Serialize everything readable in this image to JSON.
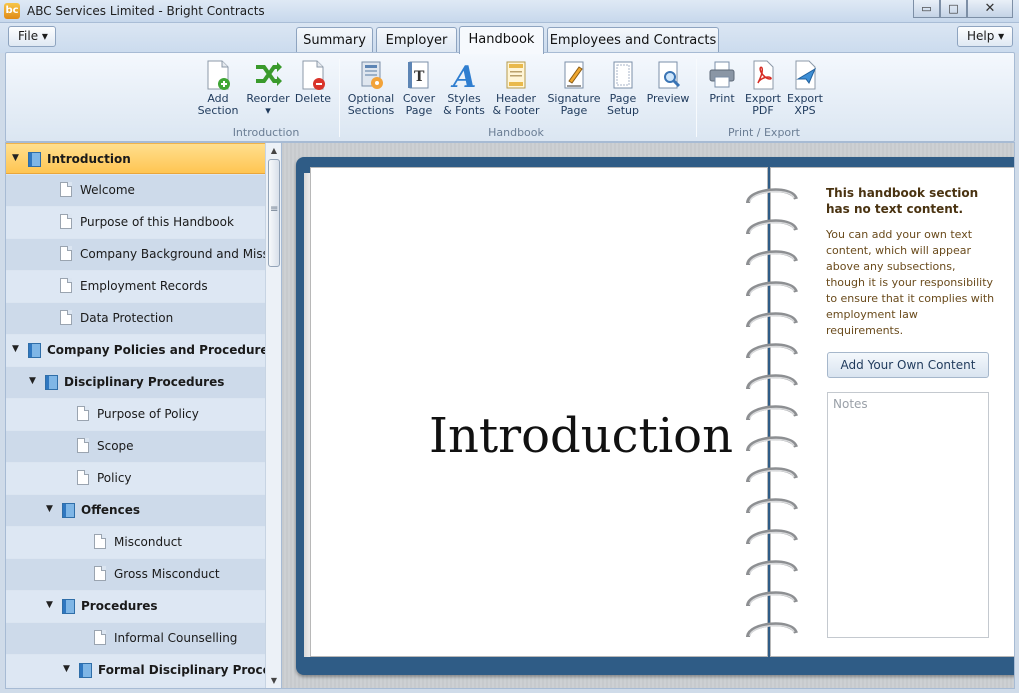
{
  "window": {
    "title": "ABC Services Limited - Bright Contracts",
    "app_icon_text": "bc",
    "minimize": "▭",
    "maximize": "□",
    "close": "✕"
  },
  "menu": {
    "file_label": "File ▾",
    "help_label": "Help ▾"
  },
  "tabs": [
    {
      "label": "Summary",
      "active": false
    },
    {
      "label": "Employer",
      "active": false
    },
    {
      "label": "Handbook",
      "active": true
    },
    {
      "label": "Employees and Contracts",
      "active": false
    }
  ],
  "ribbon": {
    "groups": [
      {
        "label": "Introduction"
      },
      {
        "label": "Handbook"
      },
      {
        "label": "Print / Export"
      }
    ],
    "buttons": [
      {
        "line1": "Add",
        "line2": "Section",
        "icon": "add-page-icon"
      },
      {
        "line1": "Reorder",
        "line2": "▾",
        "icon": "reorder-icon"
      },
      {
        "line1": "Delete",
        "line2": "",
        "icon": "delete-page-icon"
      },
      {
        "line1": "Optional",
        "line2": "Sections",
        "icon": "optional-sections-icon"
      },
      {
        "line1": "Cover",
        "line2": "Page",
        "icon": "cover-page-icon"
      },
      {
        "line1": "Styles",
        "line2": "& Fonts",
        "icon": "styles-icon"
      },
      {
        "line1": "Header",
        "line2": "& Footer",
        "icon": "header-footer-icon"
      },
      {
        "line1": "Signature",
        "line2": "Page",
        "icon": "signature-icon"
      },
      {
        "line1": "Page",
        "line2": "Setup",
        "icon": "page-setup-icon"
      },
      {
        "line1": "Preview",
        "line2": "",
        "icon": "preview-icon"
      },
      {
        "line1": "Print",
        "line2": "",
        "icon": "printer-icon"
      },
      {
        "line1": "Export",
        "line2": "PDF",
        "icon": "pdf-icon"
      },
      {
        "line1": "Export",
        "line2": "XPS",
        "icon": "xps-icon"
      }
    ]
  },
  "tree": [
    {
      "label": "Introduction",
      "level": 0,
      "type": "book",
      "expanded": true,
      "selected": true
    },
    {
      "label": "Welcome",
      "level": 1,
      "type": "page"
    },
    {
      "label": "Purpose of this Handbook",
      "level": 1,
      "type": "page"
    },
    {
      "label": "Company Background and Missio...",
      "level": 1,
      "type": "page"
    },
    {
      "label": "Employment Records",
      "level": 1,
      "type": "page"
    },
    {
      "label": "Data Protection",
      "level": 1,
      "type": "page"
    },
    {
      "label": "Company Policies and Procedures",
      "level": 0,
      "type": "book",
      "expanded": true
    },
    {
      "label": "Disciplinary Procedures",
      "level": 1,
      "type": "book",
      "expanded": true
    },
    {
      "label": "Purpose of Policy",
      "level": 2,
      "type": "page"
    },
    {
      "label": "Scope",
      "level": 2,
      "type": "page"
    },
    {
      "label": "Policy",
      "level": 2,
      "type": "page"
    },
    {
      "label": "Offences",
      "level": 2,
      "type": "book",
      "expanded": true
    },
    {
      "label": "Misconduct",
      "level": 3,
      "type": "page"
    },
    {
      "label": "Gross Misconduct",
      "level": 3,
      "type": "page"
    },
    {
      "label": "Procedures",
      "level": 2,
      "type": "book",
      "expanded": true
    },
    {
      "label": "Informal Counselling",
      "level": 3,
      "type": "page"
    },
    {
      "label": "Formal Disciplinary Proced...",
      "level": 3,
      "type": "book",
      "expanded": true
    }
  ],
  "book": {
    "page_title": "Introduction",
    "info_title": "This handbook section has no text content.",
    "info_body": "You can add your own text content, which will appear above any subsections, though it is your responsibility to ensure that it complies with employment law requirements.",
    "add_button": "Add Your Own Content",
    "notes_placeholder": "Notes"
  }
}
